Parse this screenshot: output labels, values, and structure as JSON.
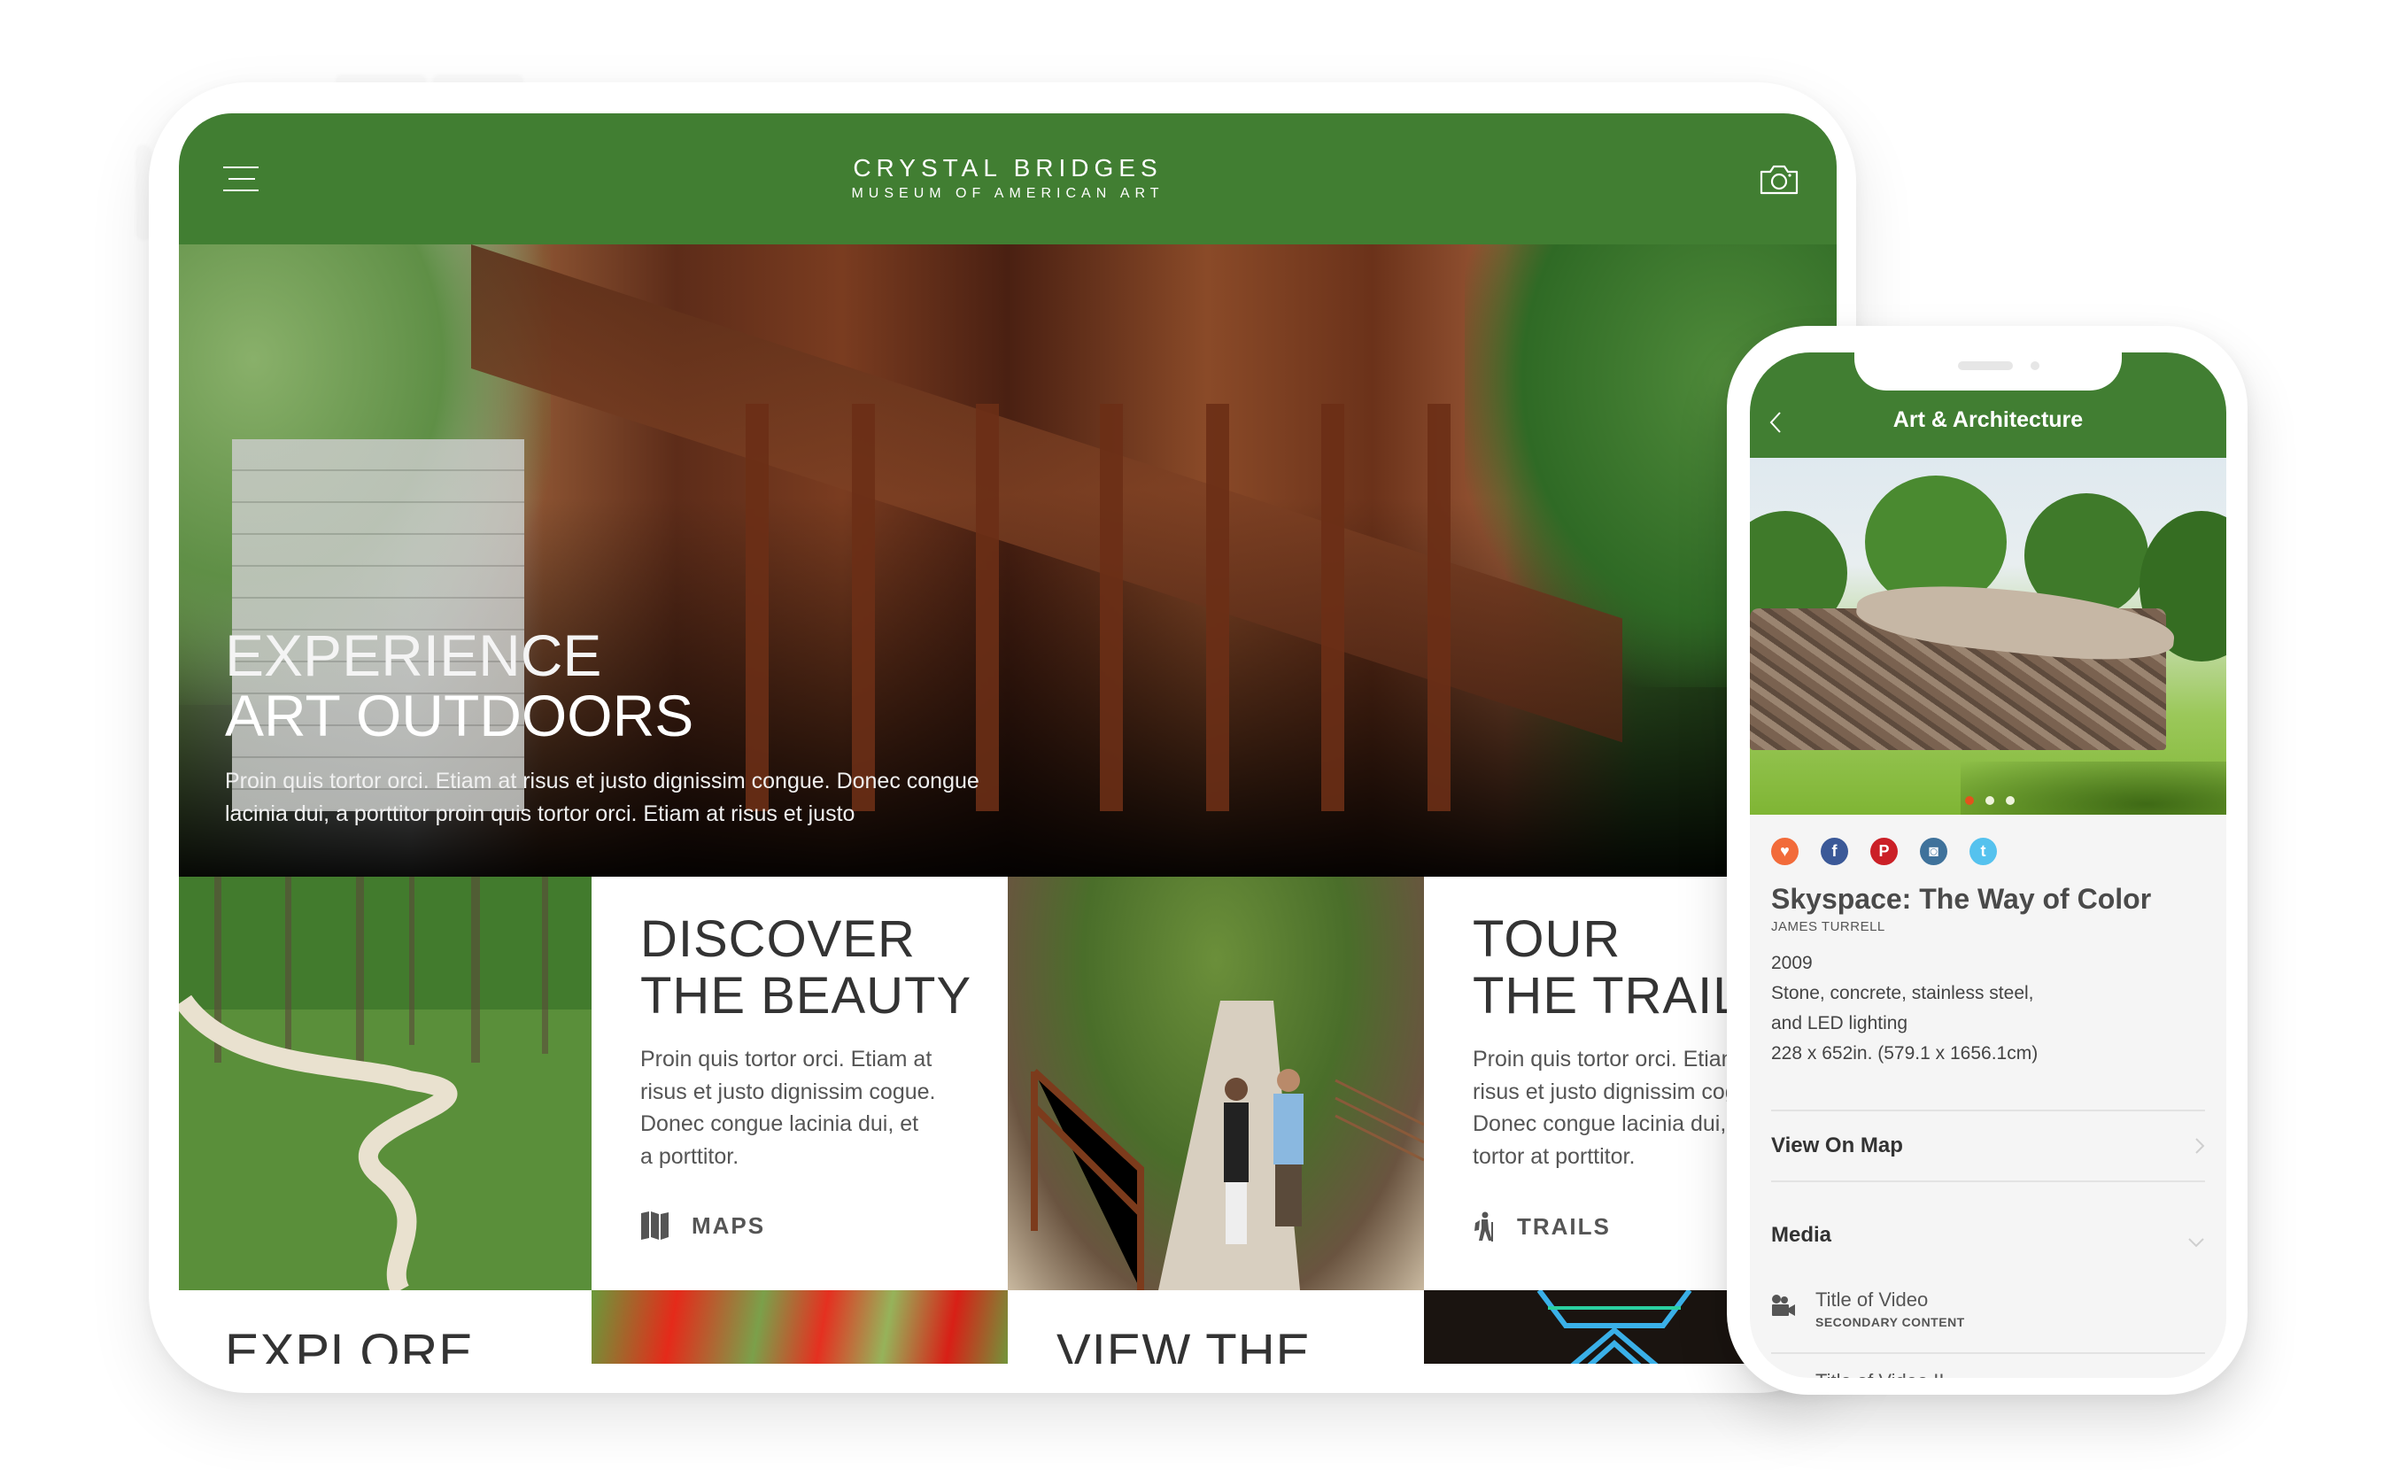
{
  "tablet": {
    "header": {
      "brand_line1": "CRYSTAL BRIDGES",
      "brand_line2": "MUSEUM OF AMERICAN ART",
      "menu_icon": "hamburger-menu-icon",
      "camera_icon": "camera-icon",
      "color": "#417e32"
    },
    "hero": {
      "title_line1": "EXPERIENCE",
      "title_line2": "ART OUTDOORS",
      "body": "Proin quis tortor orci. Etiam at risus et justo dignissim congue. Donec congue lacinia dui, a porttitor proin quis tortor orci. Etiam at risus et justo"
    },
    "tiles": [
      {
        "title_line1": "DISCOVER",
        "title_line2": "THE BEAUTY",
        "body_lines": [
          "Proin quis tortor orci. Etiam at",
          "risus et justo dignissim cogue.",
          "Donec congue lacinia dui, et",
          "a porttitor."
        ],
        "link_label": "MAPS",
        "link_icon": "map-icon"
      },
      {
        "title_line1": "TOUR",
        "title_line2": "THE TRAIL",
        "body_lines": [
          "Proin quis tortor orci. Etiam at",
          "risus et justo dignissim cogue.",
          "Donec congue lacinia dui, et",
          "tortor at porttitor."
        ],
        "link_label": "TRAILS",
        "link_icon": "hiker-icon"
      }
    ],
    "tiles_row2": [
      {
        "title_line1": "EXPLORE"
      },
      {
        "title_line1": "VIEW THE"
      }
    ]
  },
  "phone": {
    "header": {
      "title": "Art & Architecture",
      "back_icon": "chevron-left-icon"
    },
    "carousel": {
      "count": 3,
      "active_index": 0
    },
    "social": [
      {
        "name": "favorite",
        "icon": "heart-icon",
        "glyph": "♥",
        "color": "#f26b3a"
      },
      {
        "name": "facebook",
        "icon": "facebook-icon",
        "glyph": "f",
        "color": "#3b5998"
      },
      {
        "name": "pinterest",
        "icon": "pinterest-icon",
        "glyph": "P",
        "color": "#cb2027"
      },
      {
        "name": "instagram",
        "icon": "instagram-icon",
        "glyph": "◙",
        "color": "#3f729b"
      },
      {
        "name": "twitter",
        "icon": "twitter-icon",
        "glyph": "t",
        "color": "#55c2ee"
      }
    ],
    "artwork": {
      "title": "Skyspace: The Way of Color",
      "artist": "JAMES TURRELL",
      "year": "2009",
      "medium_line1": "Stone, concrete, stainless steel,",
      "medium_line2": "and LED lighting",
      "dimensions": "228 x 652in. (579.1 x 1656.1cm)"
    },
    "view_on_map": "View On Map",
    "media": {
      "label": "Media",
      "items": [
        {
          "title": "Title of Video",
          "subtitle": "SECONDARY CONTENT"
        },
        {
          "title": "Title of Video II"
        }
      ]
    }
  }
}
